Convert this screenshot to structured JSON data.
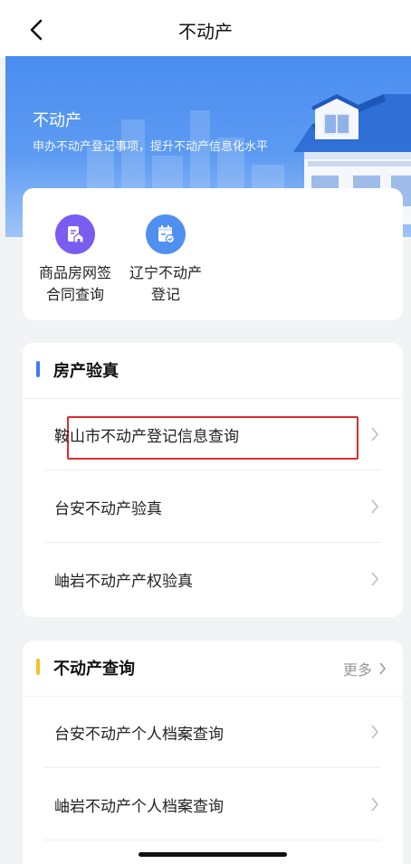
{
  "nav": {
    "title": "不动产"
  },
  "hero": {
    "title": "不动产",
    "subtitle": "申办不动产登记事项，提升不动产信息化水平"
  },
  "quick": [
    {
      "line1": "商品房网签",
      "line2": "合同查询",
      "icon": "house-document-icon",
      "color": "#7a5cf0"
    },
    {
      "line1": "辽宁不动产",
      "line2": "登记",
      "icon": "calendar-check-icon",
      "color": "#4f8ff0"
    }
  ],
  "verify": {
    "title": "房产验真",
    "accent": "#3d7cf0",
    "items": [
      {
        "label": "鞍山市不动产登记信息查询"
      },
      {
        "label": "台安不动产验真"
      },
      {
        "label": "岫岩不动产产权验真"
      }
    ]
  },
  "query": {
    "title": "不动产查询",
    "accent": "#f5c125",
    "more": "更多",
    "items": [
      {
        "label": "台安不动产个人档案查询"
      },
      {
        "label": "岫岩不动产个人档案查询"
      }
    ]
  }
}
